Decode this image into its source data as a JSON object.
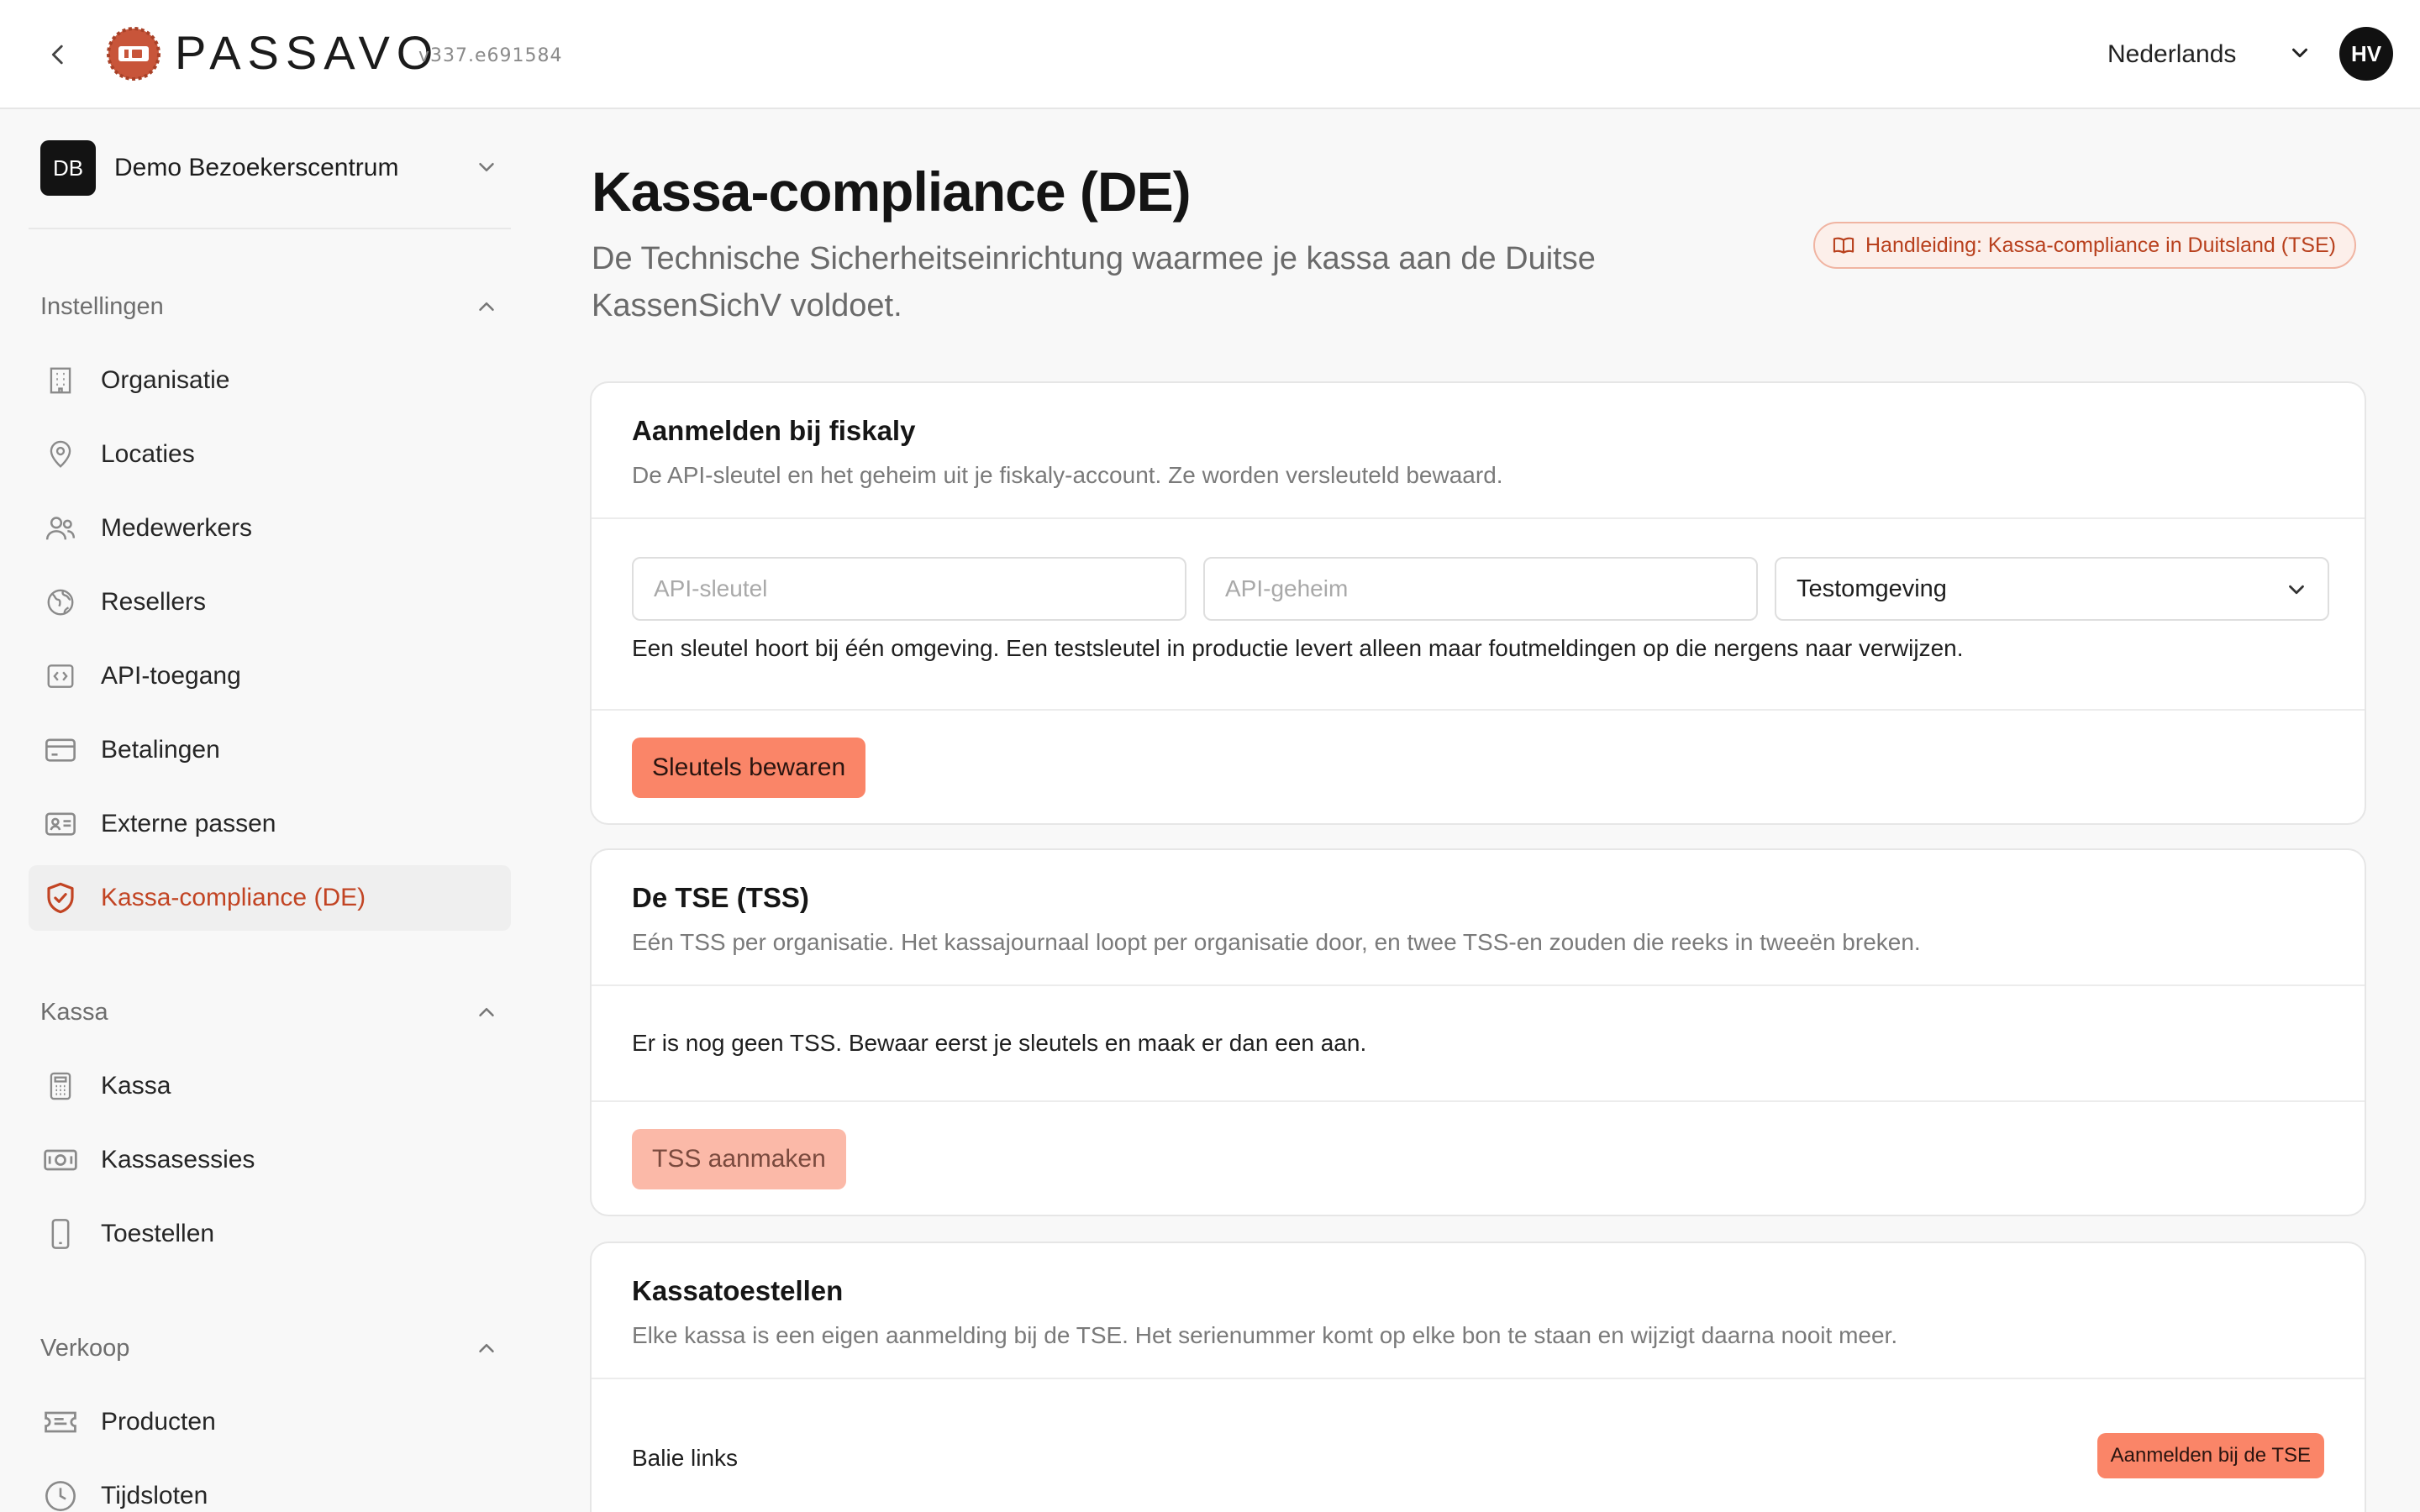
{
  "header": {
    "brand": "PASSAVO",
    "version": "v337.e691584",
    "language": "Nederlands",
    "avatar_initials": "HV"
  },
  "sidebar": {
    "org": {
      "initials": "DB",
      "name": "Demo Bezoekerscentrum"
    },
    "sections": [
      {
        "title": "Instellingen",
        "items": [
          {
            "label": "Organisatie",
            "icon": "building-icon"
          },
          {
            "label": "Locaties",
            "icon": "map-pin-icon"
          },
          {
            "label": "Medewerkers",
            "icon": "users-icon"
          },
          {
            "label": "Resellers",
            "icon": "globe-icon"
          },
          {
            "label": "API-toegang",
            "icon": "code-icon"
          },
          {
            "label": "Betalingen",
            "icon": "credit-card-icon"
          },
          {
            "label": "Externe passen",
            "icon": "id-card-icon"
          },
          {
            "label": "Kassa-compliance (DE)",
            "icon": "shield-check-icon",
            "active": true
          }
        ]
      },
      {
        "title": "Kassa",
        "items": [
          {
            "label": "Kassa",
            "icon": "calculator-icon"
          },
          {
            "label": "Kassasessies",
            "icon": "banknote-icon"
          },
          {
            "label": "Toestellen",
            "icon": "smartphone-icon"
          }
        ]
      },
      {
        "title": "Verkoop",
        "items": [
          {
            "label": "Producten",
            "icon": "ticket-icon"
          },
          {
            "label": "Tijdsloten",
            "icon": "clock-icon"
          }
        ]
      }
    ]
  },
  "page": {
    "title": "Kassa-compliance (DE)",
    "subtitle": "De Technische Sicherheitseinrichtung waarmee je kassa aan de Duitse KassenSichV voldoet.",
    "manual_link": "Handleiding: Kassa-compliance in Duitsland (TSE)"
  },
  "card_fiskaly": {
    "title": "Aanmelden bij fiskaly",
    "description": "De API-sleutel en het geheim uit je fiskaly-account. Ze worden versleuteld bewaard.",
    "api_key_placeholder": "API-sleutel",
    "api_secret_placeholder": "API-geheim",
    "environment": "Testomgeving",
    "note": "Een sleutel hoort bij één omgeving. Een testsleutel in productie levert alleen maar foutmeldingen op die nergens naar verwijzen.",
    "save_button": "Sleutels bewaren"
  },
  "card_tss": {
    "title": "De TSE (TSS)",
    "description": "Eén TSS per organisatie. Het kassajournaal loopt per organisatie door, en twee TSS-en zouden die reeks in tweeën breken.",
    "status": "Er is nog geen TSS. Bewaar eerst je sleutels en maak er dan een aan.",
    "create_button": "TSS aanmaken"
  },
  "card_devices": {
    "title": "Kassatoestellen",
    "description": "Elke kassa is een eigen aanmelding bij de TSE. Het serienummer komt op elke bon te staan en wijzigt daarna nooit meer.",
    "devices": [
      {
        "name": "Balie links",
        "action": "Aanmelden bij de TSE"
      }
    ]
  },
  "colors": {
    "accent": "#fa8568",
    "accent_text": "#c24423",
    "brand_logo": "#c8553a"
  }
}
